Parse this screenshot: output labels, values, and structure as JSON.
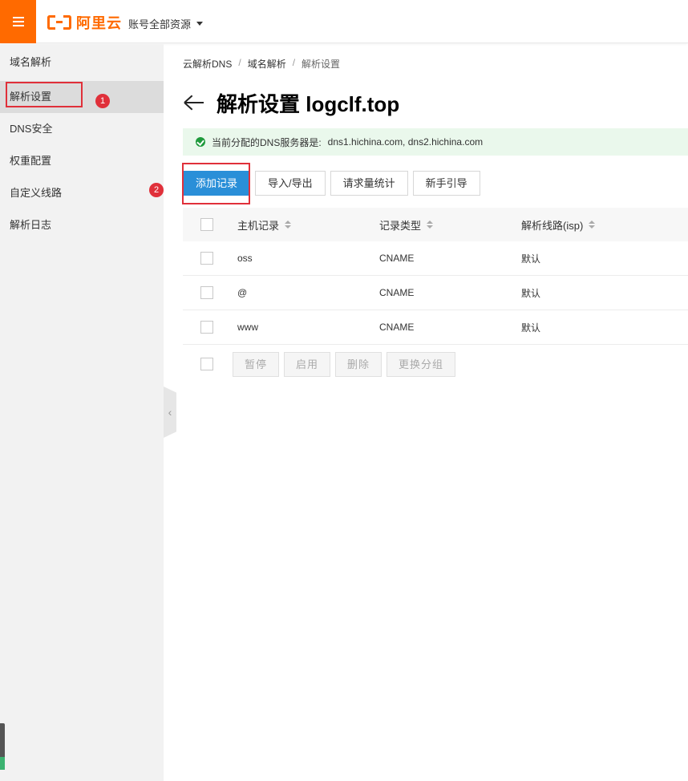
{
  "header": {
    "logo_text": "阿里云",
    "account_label": "账号全部资源"
  },
  "sidebar": {
    "items": [
      {
        "label": "域名解析"
      },
      {
        "label": "解析设置"
      },
      {
        "label": "DNS安全"
      },
      {
        "label": "权重配置"
      },
      {
        "label": "自定义线路"
      },
      {
        "label": "解析日志"
      }
    ],
    "badges": [
      "1",
      "2"
    ]
  },
  "breadcrumb": [
    "云解析DNS",
    "域名解析",
    "解析设置"
  ],
  "page": {
    "title": "解析设置 logclf.top"
  },
  "notice": {
    "prefix": "当前分配的DNS服务器是:",
    "servers": "dns1.hichina.com, dns2.hichina.com"
  },
  "toolbar": {
    "add_record": "添加记录",
    "import_export": "导入/导出",
    "request_stats": "请求量统计",
    "beginner_guide": "新手引导"
  },
  "table": {
    "columns": [
      "主机记录",
      "记录类型",
      "解析线路(isp)"
    ],
    "rows": [
      {
        "host": "oss",
        "type": "CNAME",
        "line": "默认"
      },
      {
        "host": "@",
        "type": "CNAME",
        "line": "默认"
      },
      {
        "host": "www",
        "type": "CNAME",
        "line": "默认"
      }
    ],
    "batch_actions": [
      "暂停",
      "启用",
      "删除",
      "更换分组"
    ]
  },
  "colors": {
    "brand_orange": "#ff6a00",
    "primary_blue": "#2a8fd8",
    "highlight_red": "#e0303a",
    "success_green": "#1e9a3c"
  }
}
